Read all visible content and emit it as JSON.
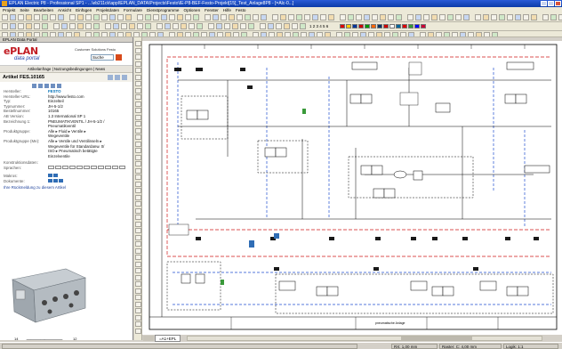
{
  "window": {
    "title": "EPLAN Electric P8 - Professional SP1 - ...\\eb211ck\\appl\\EPLAN_DATA\\Projects\\Festo\\IE-P8-BEF-Festo-Projekt[15]_Test_Anlage8P8 - [=Alc-0...]",
    "colors": {
      "titlebar": "#0b3ba8",
      "accent": "#c21d24"
    }
  },
  "menu": {
    "items": [
      "Projekt",
      "Seite",
      "Bearbeiten",
      "Ansicht",
      "Einfügen",
      "Projektdaten",
      "Formulare",
      "Dienstprogramme",
      "Optionen",
      "Fenster",
      "Hilfe",
      "Festo"
    ]
  },
  "toolbar": {
    "page_numbers": "1 2 3 4 5 6"
  },
  "left_panel": {
    "caption": "EPLAN Data Portal",
    "logo_text": "ePLAN",
    "logo_sub": "data portal",
    "customer": "Customer Solutions Festo",
    "search": {
      "value": "Suche"
    },
    "nav_links": "Artikelanfrage | Nutzungsbedingungen | News",
    "article_title": "Artikel FES.10165",
    "properties": [
      {
        "key": "Hersteller:",
        "value": "FESTO",
        "brand": true
      },
      {
        "key": "Hersteller-URL:",
        "value": "http://www.festo.com"
      },
      {
        "key": "Typ:",
        "value": "Einzelteil"
      },
      {
        "key": "Typnummer:",
        "value": "JH-5-1/2"
      },
      {
        "key": "Bestellnummer:",
        "value": "10165"
      },
      {
        "key": "AB Version:",
        "value": "1.3 International SP 1"
      },
      {
        "key": "Bezeichnung 1:",
        "value": "PNEUMATIKVENTIL / JH-5-1/2 /"
      },
      {
        "key": "",
        "value": "Pneumatikventil"
      },
      {
        "key": "Produktgruppe:",
        "value": "Alle ▸ Fluid ▸ Ventile ▸"
      },
      {
        "key": "",
        "value": "Wegeventile"
      },
      {
        "key": "Produktgruppe (Me):",
        "value": "Alle ▸ Ventile und Ventilinseln ▸"
      },
      {
        "key": "",
        "value": "Wegeventile für Standardanw. 0/"
      },
      {
        "key": "",
        "value": "ISO ▸ Pneumatisch betätigte"
      },
      {
        "key": "",
        "value": "Einzelventile"
      }
    ],
    "extra_labels": {
      "mechanical": "Konstruktionsdaten:",
      "languages": "Sprachen:",
      "macros": "Makros:",
      "documents": "Dokumente:"
    },
    "bookmark_link": "Ihre Rückmeldung zu diesem Artikel"
  },
  "canvas": {
    "sheet_tab": "=A1+EPL",
    "title_block_text": "pneumatische Anlage"
  },
  "status_bar": {
    "left": "",
    "coords": "RX: 1,00 mm",
    "grid": "Raster: C: 4,00 mm",
    "logic": "Logik: 1:1"
  }
}
